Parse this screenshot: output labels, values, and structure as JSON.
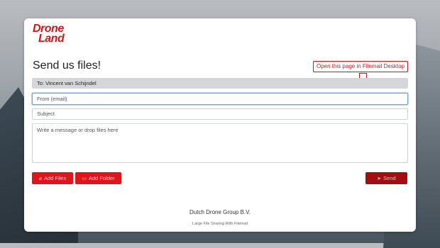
{
  "brand": {
    "logo_line1": "Drone",
    "logo_line2": "Land",
    "color": "#d0161c"
  },
  "page": {
    "title": "Send us files!",
    "desktop_button_label": "Open this page in Filemail Desktop",
    "desktop_button_icon": "monitor-icon"
  },
  "form": {
    "to_label": "To: Vincent van Schijndel",
    "from_placeholder": "From (email)",
    "subject_placeholder": "Subject",
    "message_placeholder": "Write a message or drop files here"
  },
  "actions": {
    "add_files_label": "Add Files",
    "add_files_icon": "paperclip-icon",
    "add_folder_label": "Add Folder",
    "add_folder_icon": "folder-icon",
    "send_label": "Send",
    "send_icon": "send-icon"
  },
  "footer": {
    "company": "Dutch Drone Group B.V.",
    "tagline": "Large File Sharing With Filemail"
  }
}
